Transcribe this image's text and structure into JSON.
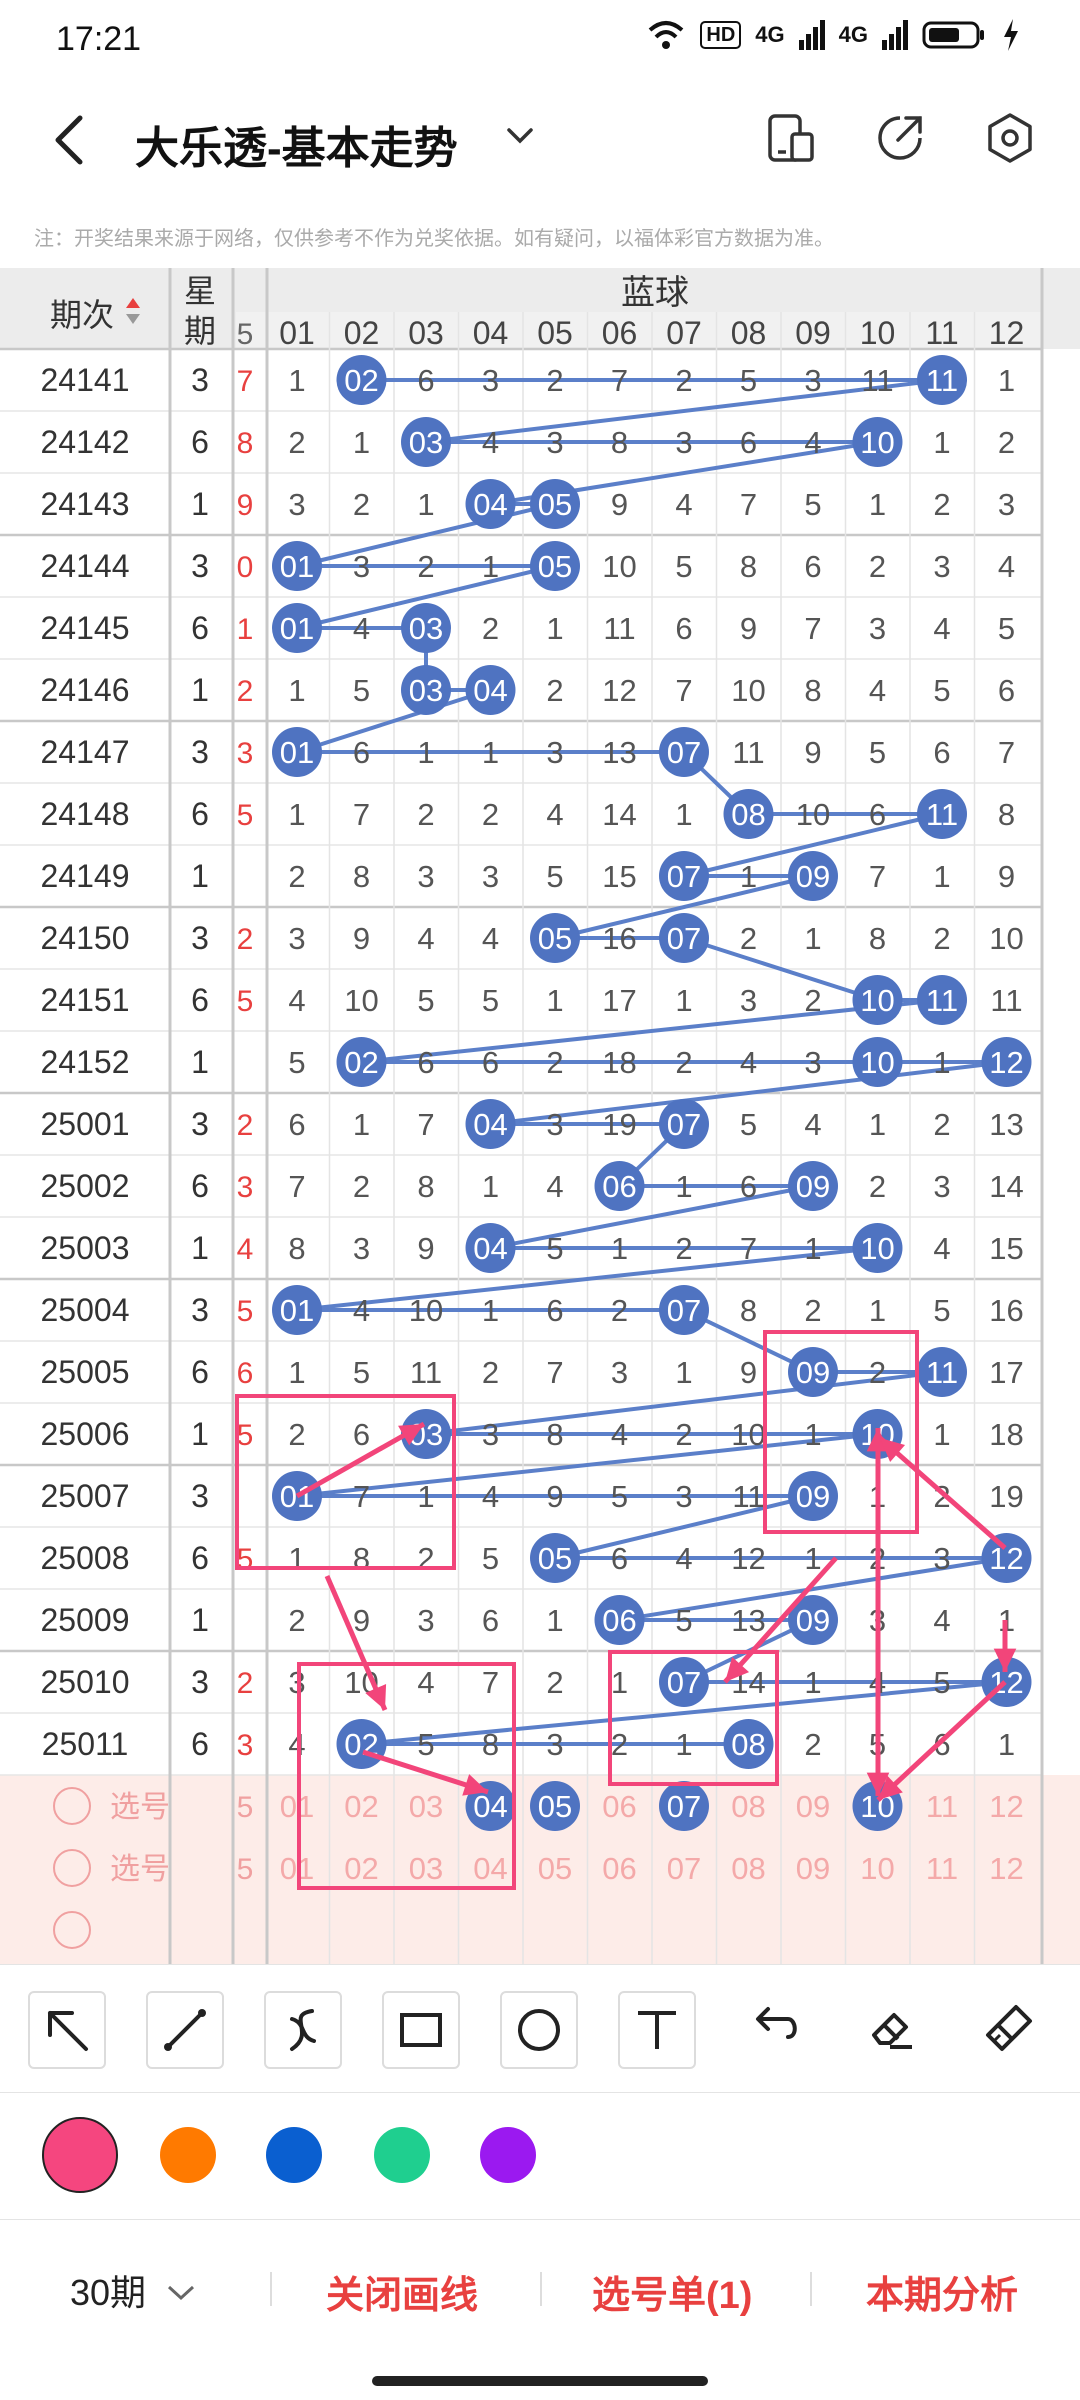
{
  "status_bar": {
    "time": "17:21",
    "hd": "HD",
    "net1": "4G",
    "net2": "4G"
  },
  "header": {
    "title": "大乐透-基本走势"
  },
  "notice": "注：开奖结果来源于网络，仅供参考不作为兑奖依据。如有疑问，以福体彩官方数据为准。",
  "table": {
    "period_header": "期次",
    "weekday_header_top": "星",
    "weekday_header_bottom": "期",
    "section_title": "蓝球",
    "partial_col_label": "5",
    "columns": [
      "01",
      "02",
      "03",
      "04",
      "05",
      "06",
      "07",
      "08",
      "09",
      "10",
      "11",
      "12"
    ],
    "rows": [
      {
        "period": "24141",
        "weekday": "3",
        "partial": "7",
        "cells": [
          "1",
          "02",
          "6",
          "3",
          "2",
          "7",
          "2",
          "5",
          "3",
          "11",
          "11",
          "1"
        ]
      },
      {
        "period": "24142",
        "weekday": "6",
        "partial": "8",
        "cells": [
          "2",
          "1",
          "03",
          "4",
          "3",
          "8",
          "3",
          "6",
          "4",
          "10",
          "1",
          "2"
        ]
      },
      {
        "period": "24143",
        "weekday": "1",
        "partial": "9",
        "cells": [
          "3",
          "2",
          "1",
          "04",
          "05",
          "9",
          "4",
          "7",
          "5",
          "1",
          "2",
          "3"
        ]
      },
      {
        "period": "24144",
        "weekday": "3",
        "partial": "0",
        "cells": [
          "01",
          "3",
          "2",
          "1",
          "05",
          "10",
          "5",
          "8",
          "6",
          "2",
          "3",
          "4"
        ]
      },
      {
        "period": "24145",
        "weekday": "6",
        "partial": "1",
        "cells": [
          "01",
          "4",
          "03",
          "2",
          "1",
          "11",
          "6",
          "9",
          "7",
          "3",
          "4",
          "5"
        ]
      },
      {
        "period": "24146",
        "weekday": "1",
        "partial": "2",
        "cells": [
          "1",
          "5",
          "03",
          "04",
          "2",
          "12",
          "7",
          "10",
          "8",
          "4",
          "5",
          "6"
        ]
      },
      {
        "period": "24147",
        "weekday": "3",
        "partial": "3",
        "cells": [
          "01",
          "6",
          "1",
          "1",
          "3",
          "13",
          "07",
          "11",
          "9",
          "5",
          "6",
          "7"
        ]
      },
      {
        "period": "24148",
        "weekday": "6",
        "partial": "5",
        "cells": [
          "1",
          "7",
          "2",
          "2",
          "4",
          "14",
          "1",
          "08",
          "10",
          "6",
          "11",
          "8"
        ]
      },
      {
        "period": "24149",
        "weekday": "1",
        "partial": "",
        "cells": [
          "2",
          "8",
          "3",
          "3",
          "5",
          "15",
          "07",
          "1",
          "09",
          "7",
          "1",
          "9"
        ]
      },
      {
        "period": "24150",
        "weekday": "3",
        "partial": "2",
        "cells": [
          "3",
          "9",
          "4",
          "4",
          "05",
          "16",
          "07",
          "2",
          "1",
          "8",
          "2",
          "10"
        ]
      },
      {
        "period": "24151",
        "weekday": "6",
        "partial": "5",
        "cells": [
          "4",
          "10",
          "5",
          "5",
          "1",
          "17",
          "1",
          "3",
          "2",
          "10",
          "11",
          "11"
        ]
      },
      {
        "period": "24152",
        "weekday": "1",
        "partial": "",
        "cells": [
          "5",
          "02",
          "6",
          "6",
          "2",
          "18",
          "2",
          "4",
          "3",
          "10",
          "1",
          "12"
        ]
      },
      {
        "period": "25001",
        "weekday": "3",
        "partial": "2",
        "cells": [
          "6",
          "1",
          "7",
          "04",
          "3",
          "19",
          "07",
          "5",
          "4",
          "1",
          "2",
          "13"
        ]
      },
      {
        "period": "25002",
        "weekday": "6",
        "partial": "3",
        "cells": [
          "7",
          "2",
          "8",
          "1",
          "4",
          "06",
          "1",
          "6",
          "09",
          "2",
          "3",
          "14"
        ]
      },
      {
        "period": "25003",
        "weekday": "1",
        "partial": "4",
        "cells": [
          "8",
          "3",
          "9",
          "04",
          "5",
          "1",
          "2",
          "7",
          "1",
          "10",
          "4",
          "15"
        ]
      },
      {
        "period": "25004",
        "weekday": "3",
        "partial": "5",
        "cells": [
          "01",
          "4",
          "10",
          "1",
          "6",
          "2",
          "07",
          "8",
          "2",
          "1",
          "5",
          "16"
        ]
      },
      {
        "period": "25005",
        "weekday": "6",
        "partial": "6",
        "cells": [
          "1",
          "5",
          "11",
          "2",
          "7",
          "3",
          "1",
          "9",
          "09",
          "2",
          "11",
          "17"
        ]
      },
      {
        "period": "25006",
        "weekday": "1",
        "partial": "5",
        "cells": [
          "2",
          "6",
          "03",
          "3",
          "8",
          "4",
          "2",
          "10",
          "1",
          "10",
          "1",
          "18"
        ]
      },
      {
        "period": "25007",
        "weekday": "3",
        "partial": "",
        "cells": [
          "01",
          "7",
          "1",
          "4",
          "9",
          "5",
          "3",
          "11",
          "09",
          "1",
          "2",
          "19"
        ]
      },
      {
        "period": "25008",
        "weekday": "6",
        "partial": "5",
        "cells": [
          "1",
          "8",
          "2",
          "5",
          "05",
          "6",
          "4",
          "12",
          "1",
          "2",
          "3",
          "12"
        ]
      },
      {
        "period": "25009",
        "weekday": "1",
        "partial": "",
        "cells": [
          "2",
          "9",
          "3",
          "6",
          "1",
          "06",
          "5",
          "13",
          "09",
          "3",
          "4",
          "1"
        ]
      },
      {
        "period": "25010",
        "weekday": "3",
        "partial": "2",
        "cells": [
          "3",
          "10",
          "4",
          "7",
          "2",
          "1",
          "07",
          "14",
          "1",
          "4",
          "5",
          "12"
        ]
      },
      {
        "period": "25011",
        "weekday": "6",
        "partial": "3",
        "cells": [
          "4",
          "02",
          "5",
          "8",
          "3",
          "2",
          "1",
          "08",
          "2",
          "5",
          "6",
          "1"
        ]
      }
    ],
    "pick_label": "选号",
    "pick_rows": [
      {
        "label": "选号",
        "selected": [
          "04",
          "05",
          "07",
          "10"
        ]
      },
      {
        "label": "选号",
        "selected": []
      }
    ]
  },
  "tools": [
    "arrow-tool",
    "line-tool",
    "curve-tool",
    "rectangle-tool",
    "circle-tool",
    "text-tool",
    "undo-tool",
    "eraser-tool",
    "clear-tool"
  ],
  "palette": [
    "#f5467f",
    "#ff7a00",
    "#0a5fd0",
    "#1fcf8f",
    "#9b19f0"
  ],
  "bottom_bar": {
    "period_select": "30期",
    "close_draw": "关闭画线",
    "pick_list": "选号单(1)",
    "analysis": "本期分析"
  },
  "colors": {
    "ball": "#4f73c1",
    "line": "#5b7fc9",
    "draw": "#f2457a",
    "red": "#e8403f"
  }
}
